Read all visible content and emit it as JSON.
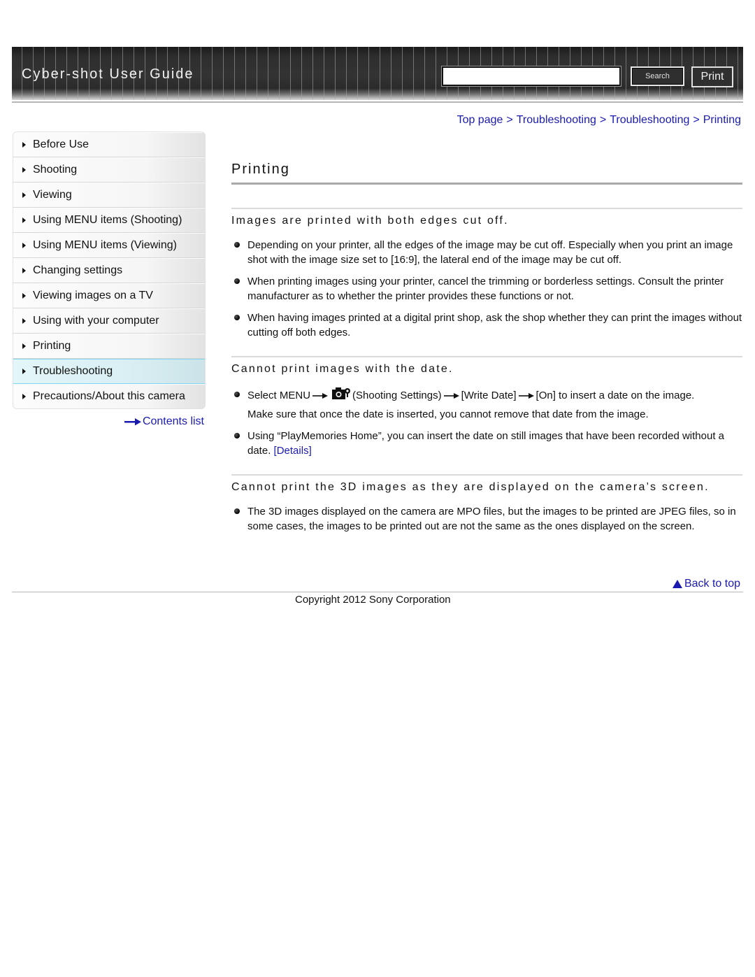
{
  "header": {
    "title": "Cyber-shot User Guide",
    "search_placeholder": "",
    "search_value": "",
    "search_label": "Search",
    "print_label": "Print"
  },
  "breadcrumb": {
    "items": [
      "Top page",
      "Troubleshooting",
      "Troubleshooting",
      "Printing"
    ],
    "separator": ">"
  },
  "sidebar": {
    "items": [
      {
        "label": "Before Use",
        "active": false
      },
      {
        "label": "Shooting",
        "active": false
      },
      {
        "label": "Viewing",
        "active": false
      },
      {
        "label": "Using MENU items (Shooting)",
        "active": false
      },
      {
        "label": "Using MENU items (Viewing)",
        "active": false
      },
      {
        "label": "Changing settings",
        "active": false
      },
      {
        "label": "Viewing images on a TV",
        "active": false
      },
      {
        "label": "Using with your computer",
        "active": false
      },
      {
        "label": "Printing",
        "active": false
      },
      {
        "label": "Troubleshooting",
        "active": true
      },
      {
        "label": "Precautions/About this camera",
        "active": false
      }
    ],
    "contents_link": "Contents list",
    "active_color": "#7fd6ec"
  },
  "main": {
    "page_title": "Printing",
    "sections": [
      {
        "title": "Images are printed with both edges cut off.",
        "bullets": [
          "Depending on your printer, all the edges of the image may be cut off. Especially when you print an image shot with the image size set to [16:9], the lateral end of the image may be cut off.",
          "When printing images using your printer, cancel the trimming or borderless settings. Consult the printer manufacturer as to whether the printer provides these functions or not.",
          "When having images printed at a digital print shop, ask the shop whether they can print the images without cutting off both edges."
        ]
      },
      {
        "title": "Cannot print images with the date.",
        "bullet1": {
          "part1": "Select MENU",
          "icon": "camera-settings-icon",
          "part2": "(Shooting Settings)",
          "part3": "[Write Date]",
          "part4": "[On] to insert a date on the image.",
          "line2": "Make sure that once the date is inserted, you cannot remove that date from the image."
        },
        "bullet2": {
          "text": "Using “PlayMemories Home”, you can insert the date on still images that have been recorded without a date.",
          "link": "[Details]"
        }
      },
      {
        "title": "Cannot print the 3D images as they are displayed on the camera’s screen.",
        "bullets": [
          "The 3D images displayed on the camera are MPO files, but the images to be printed are JPEG files, so in some cases, the images to be printed out are not the same as the ones displayed on the screen."
        ]
      }
    ]
  },
  "footer": {
    "back_to_top": "Back to top",
    "copyright": "Copyright 2012 Sony Corporation"
  },
  "colors": {
    "link": "#1a1ab0",
    "header_bg": "#2c2c2c"
  }
}
